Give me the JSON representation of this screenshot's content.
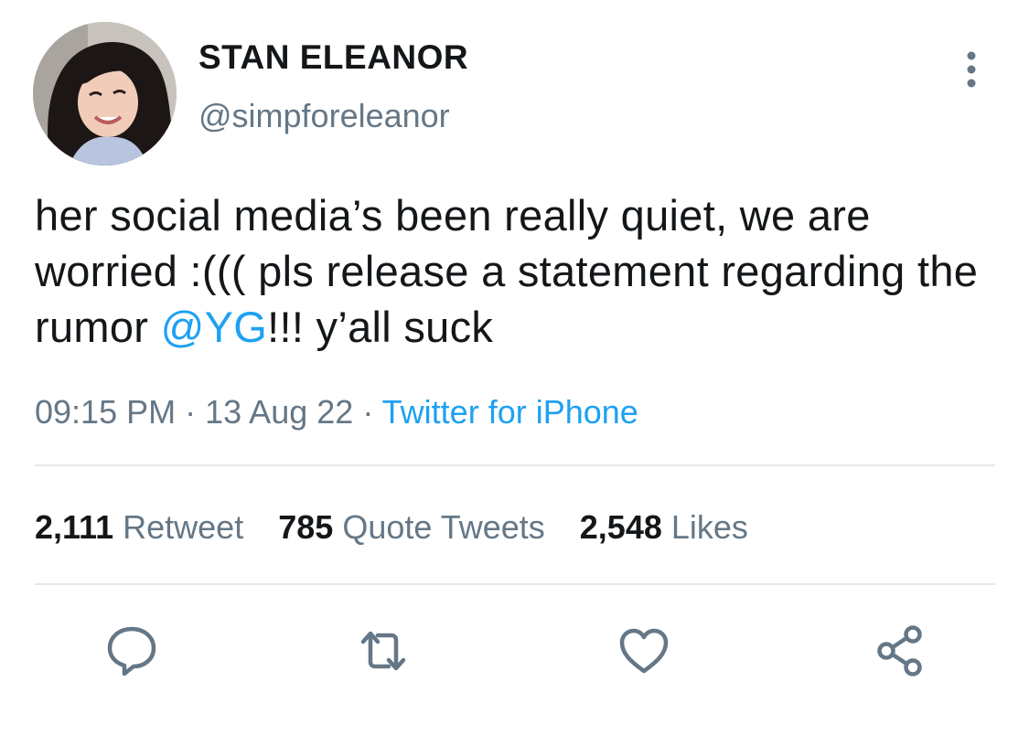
{
  "user": {
    "display_name": "STAN ELEANOR",
    "handle": "@simpforeleanor",
    "avatar_icon": "profile-photo"
  },
  "tweet": {
    "text_before": "her social media’s been really quiet, we are worried :((( pls release a statement regarding the rumor ",
    "mention": "@YG",
    "text_after": "!!! y’all suck"
  },
  "meta": {
    "time": "09:15 PM",
    "date": "13 Aug 22",
    "separator": "·",
    "source": "Twitter for iPhone"
  },
  "stats": {
    "retweets_count": "2,111",
    "retweets_label": "Retweet",
    "quotes_count": "785",
    "quotes_label": "Quote Tweets",
    "likes_count": "2,548",
    "likes_label": "Likes"
  },
  "actions": {
    "reply_icon": "reply-icon",
    "retweet_icon": "retweet-icon",
    "like_icon": "heart-icon",
    "share_icon": "share-icon",
    "more_icon": "more-vertical-icon"
  },
  "colors": {
    "accent": "#1da1f2",
    "secondary_text": "#657786",
    "primary_text": "#14171a",
    "divider": "#e1e8ed"
  }
}
